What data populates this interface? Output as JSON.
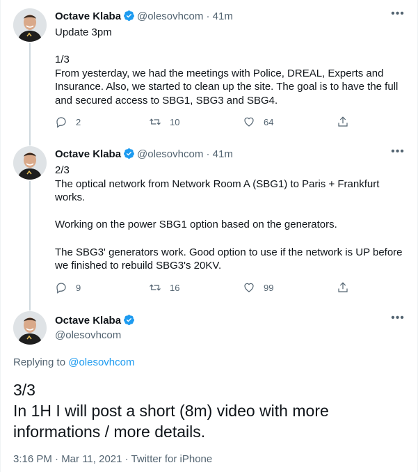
{
  "tweets": [
    {
      "name": "Octave Klaba",
      "handle": "@olesovhcom",
      "sep": "·",
      "time": "41m",
      "text": "Update 3pm\n\n1/3\nFrom yesterday, we had the meetings with Police, DREAL, Experts and Insurance. Also, we started to clean up the site. The goal is to have the full and secured access to SBG1, SBG3 and SBG4.",
      "replies": "2",
      "retweets": "10",
      "likes": "64"
    },
    {
      "name": "Octave Klaba",
      "handle": "@olesovhcom",
      "sep": "·",
      "time": "41m",
      "text": "2/3\nThe optical network from Network Room A (SBG1) to Paris + Frankfurt works.\n\nWorking on the power SBG1 option based on the generators.\n\nThe SBG3' generators work. Good option to use if the network is UP before we finished to rebuild SBG3's 20KV.",
      "replies": "9",
      "retweets": "16",
      "likes": "99"
    }
  ],
  "main": {
    "name": "Octave Klaba",
    "handle": "@olesovhcom",
    "replying_prefix": "Replying to",
    "replying_to": "@olesovhcom",
    "text": "3/3\nIn 1H I will post a short (8m) video with more informations / more details.",
    "meta": "3:16 PM · Mar 11, 2021 · Twitter for iPhone"
  },
  "icons": {
    "verified": "verified-badge-icon",
    "reply": "reply-icon",
    "retweet": "retweet-icon",
    "like": "heart-icon",
    "share": "share-icon",
    "more": "more-icon"
  },
  "colors": {
    "accent": "#1d9bf0",
    "secondary_text": "#536471",
    "thread_line": "#cfd9de"
  }
}
